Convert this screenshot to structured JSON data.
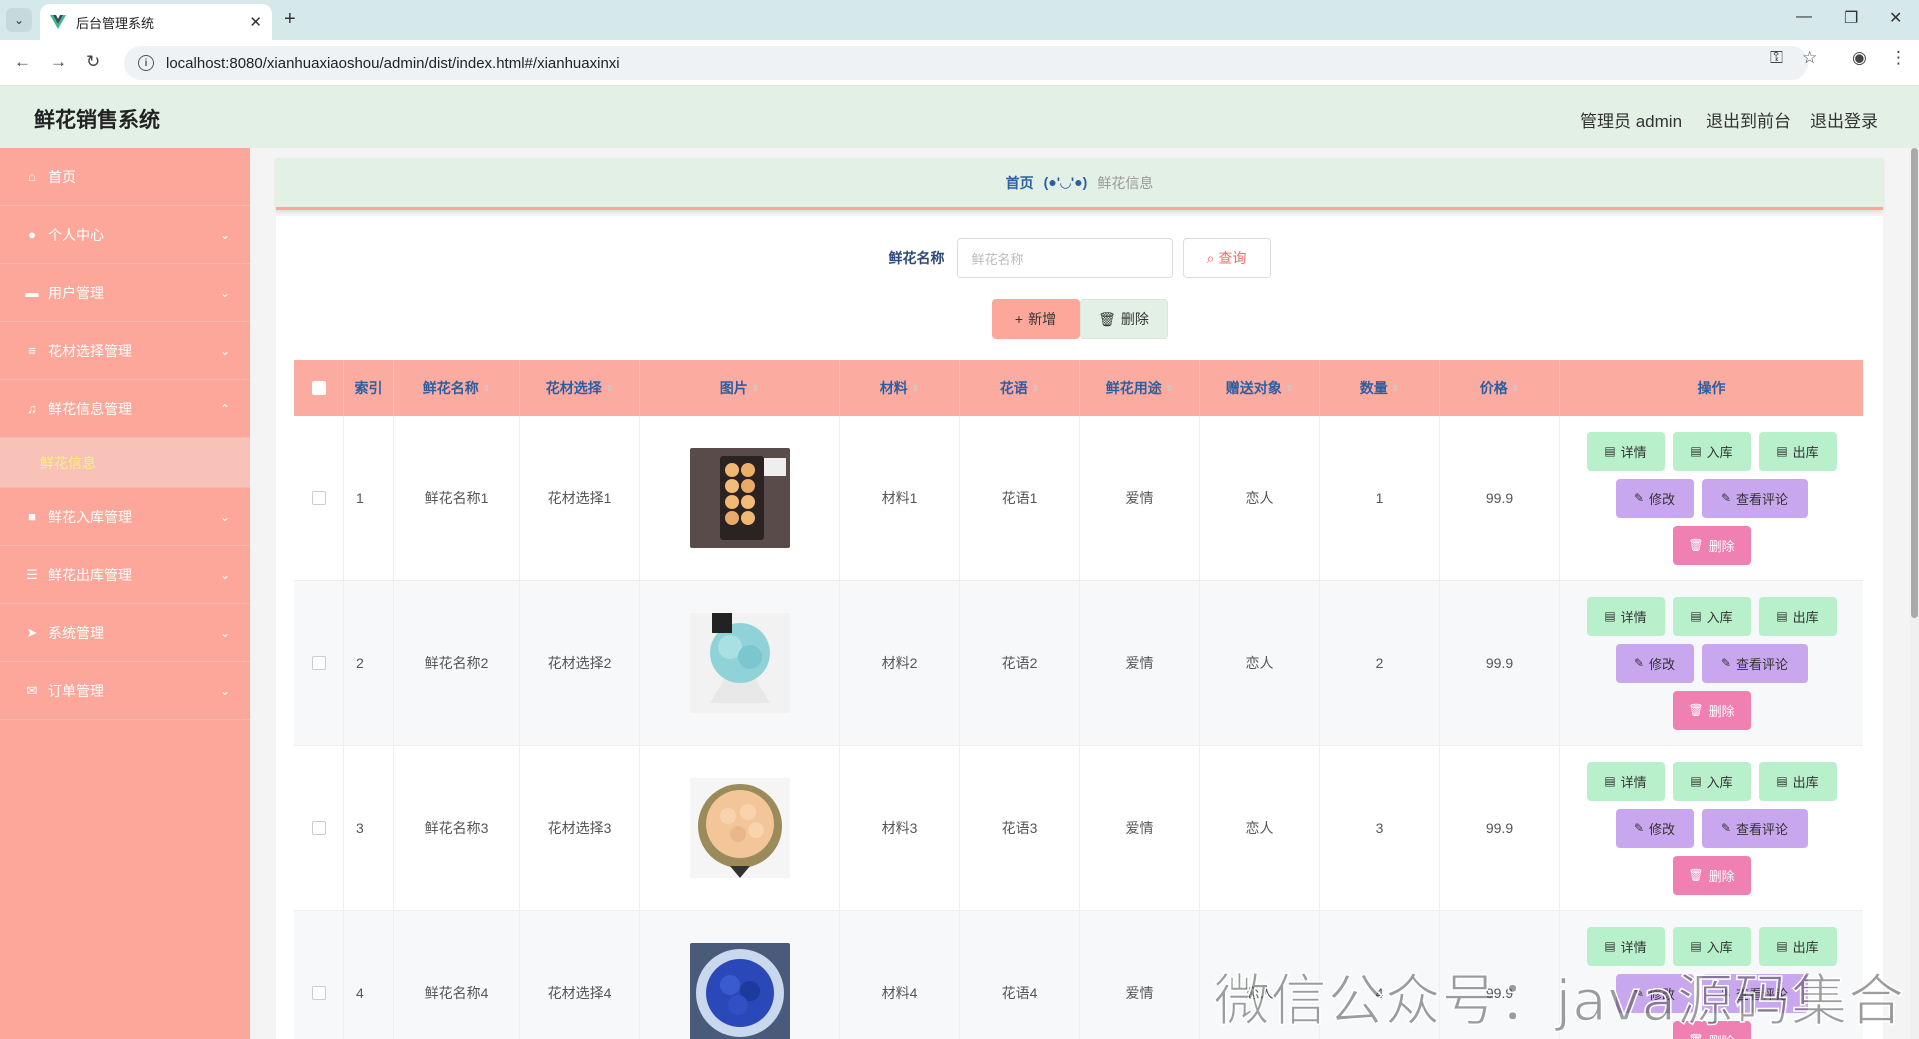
{
  "browser": {
    "tab_title": "后台管理系统",
    "url": "localhost:8080/xianhuaxiaoshou/admin/dist/index.html#/xianhuaxinxi"
  },
  "header": {
    "logo": "鲜花销售系统",
    "admin_label": "管理员 admin",
    "front_link": "退出到前台",
    "logout_link": "退出登录"
  },
  "sidebar": {
    "items": [
      {
        "label": "首页",
        "icon": "home-icon"
      },
      {
        "label": "个人中心",
        "icon": "user-icon"
      },
      {
        "label": "用户管理",
        "icon": "chat-icon"
      },
      {
        "label": "花材选择管理",
        "icon": "list-icon"
      },
      {
        "label": "鲜花信息管理",
        "icon": "bell-off-icon"
      },
      {
        "label": "鲜花入库管理",
        "icon": "folder-icon"
      },
      {
        "label": "鲜花出库管理",
        "icon": "sliders-icon"
      },
      {
        "label": "系统管理",
        "icon": "send-icon"
      },
      {
        "label": "订单管理",
        "icon": "mail-icon"
      }
    ],
    "active_sub": "鲜花信息"
  },
  "breadcrumb": {
    "home": "首页",
    "separator": "(●'◡'●)",
    "current": "鲜花信息"
  },
  "search": {
    "label": "鲜花名称",
    "placeholder": "鲜花名称",
    "button": "查询"
  },
  "actions": {
    "add": "新增",
    "delete": "删除"
  },
  "table": {
    "headers": [
      "索引",
      "鲜花名称",
      "花材选择",
      "图片",
      "材料",
      "花语",
      "鲜花用途",
      "赠送对象",
      "数量",
      "价格",
      "操作"
    ],
    "rows": [
      {
        "index": "1",
        "name": "鲜花名称1",
        "choice": "花材选择1",
        "material": "材料1",
        "language": "花语1",
        "usage": "爱情",
        "target": "恋人",
        "qty": "1",
        "price": "99.9"
      },
      {
        "index": "2",
        "name": "鲜花名称2",
        "choice": "花材选择2",
        "material": "材料2",
        "language": "花语2",
        "usage": "爱情",
        "target": "恋人",
        "qty": "2",
        "price": "99.9"
      },
      {
        "index": "3",
        "name": "鲜花名称3",
        "choice": "花材选择3",
        "material": "材料3",
        "language": "花语3",
        "usage": "爱情",
        "target": "恋人",
        "qty": "3",
        "price": "99.9"
      },
      {
        "index": "4",
        "name": "鲜花名称4",
        "choice": "花材选择4",
        "material": "材料4",
        "language": "花语4",
        "usage": "爱情",
        "target": "恋人",
        "qty": "4",
        "price": "99.9"
      }
    ],
    "ops": {
      "detail": "详情",
      "instock": "入库",
      "outstock": "出库",
      "edit": "修改",
      "review": "查看评论",
      "remove": "删除"
    }
  },
  "watermark": "微信公众号：java源码集合",
  "colors": {
    "sidebar": "#fda79a",
    "header": "#e3f0e6",
    "table_header": "#fbaba0",
    "green_btn": "#b8f0cc",
    "purple_btn": "#c9a7ee",
    "pink_btn": "#f07fb2"
  }
}
